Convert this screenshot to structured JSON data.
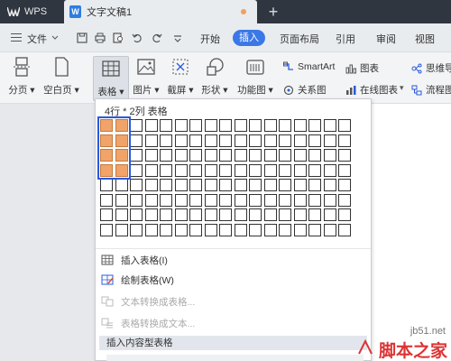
{
  "titlebar": {
    "app_tab": "WPS",
    "doc_tab": "文字文稿1",
    "doc_icon": "W",
    "add_tab": "+"
  },
  "menubar": {
    "file": "文件",
    "tabs": [
      "开始",
      "插入",
      "页面布局",
      "引用",
      "审阅",
      "视图"
    ],
    "active_tab": "插入"
  },
  "ribbon": {
    "buttons": [
      "分页",
      "空白页",
      "表格",
      "图片",
      "截屏",
      "形状",
      "功能图"
    ],
    "smartart": "SmartArt",
    "chart": "图表",
    "mindmap": "思维导",
    "relation": "关系图",
    "online_chart": "在线图表",
    "flowchart": "流程图"
  },
  "table_dropdown": {
    "status": "4行 * 2列 表格",
    "grid_rows": 8,
    "grid_cols": 17,
    "selected_rows": 4,
    "selected_cols": 2,
    "items": [
      {
        "label": "插入表格(I)",
        "enabled": true
      },
      {
        "label": "绘制表格(W)",
        "enabled": true
      },
      {
        "label": "文本转换成表格...",
        "enabled": false
      },
      {
        "label": "表格转换成文本...",
        "enabled": false
      }
    ],
    "section": "插入内容型表格"
  },
  "watermark": {
    "site": "jb51.net",
    "name": "脚本之家"
  },
  "colors": {
    "titlebar": "#2f3640",
    "accent": "#3b78e7",
    "selected_cell": "#f0a46a",
    "selection_frame": "#2a5bd7",
    "doc_dot": "#f0a060"
  }
}
